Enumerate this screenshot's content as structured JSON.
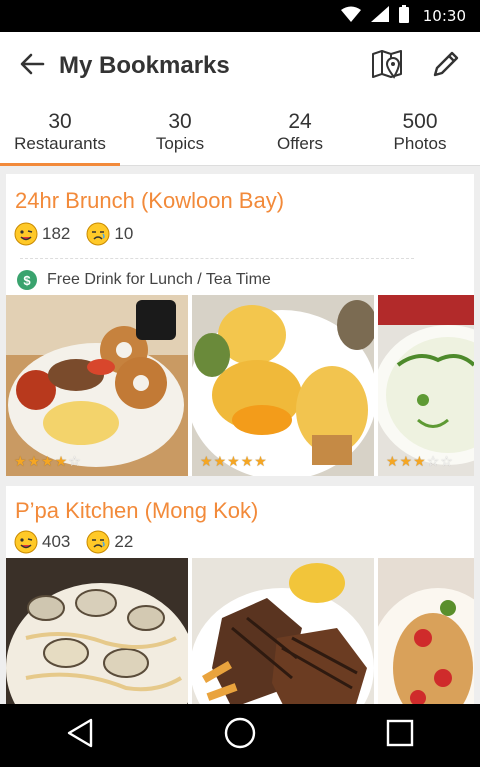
{
  "status_bar": {
    "time": "10:30",
    "icons": [
      "wifi-icon",
      "signal-icon",
      "battery-icon"
    ]
  },
  "app_bar": {
    "title": "My Bookmarks",
    "back_icon": "arrow-left-icon",
    "map_icon": "map-pin-icon",
    "edit_icon": "pencil-icon"
  },
  "tabs": [
    {
      "count": "30",
      "label": "Restaurants",
      "active": true
    },
    {
      "count": "30",
      "label": "Topics",
      "active": false
    },
    {
      "count": "24",
      "label": "Offers",
      "active": false
    },
    {
      "count": "500",
      "label": "Photos",
      "active": false
    }
  ],
  "restaurants": [
    {
      "name": "24hr Brunch (Kowloon Bay)",
      "smile_count": "182",
      "cry_count": "10",
      "offer": "Free Drink for Lunch / Tea Time",
      "photo_ratings": [
        4,
        5,
        3
      ]
    },
    {
      "name": "P’pa Kitchen (Mong Kok)",
      "smile_count": "403",
      "cry_count": "22"
    }
  ],
  "colors": {
    "accent": "#f28a3a",
    "offer_green": "#3aa36e",
    "star": "#f5a623",
    "tab_underline": "#f28a3a"
  },
  "nav_bar": {
    "icons": [
      "back-triangle-icon",
      "home-circle-icon",
      "recents-square-icon"
    ]
  }
}
